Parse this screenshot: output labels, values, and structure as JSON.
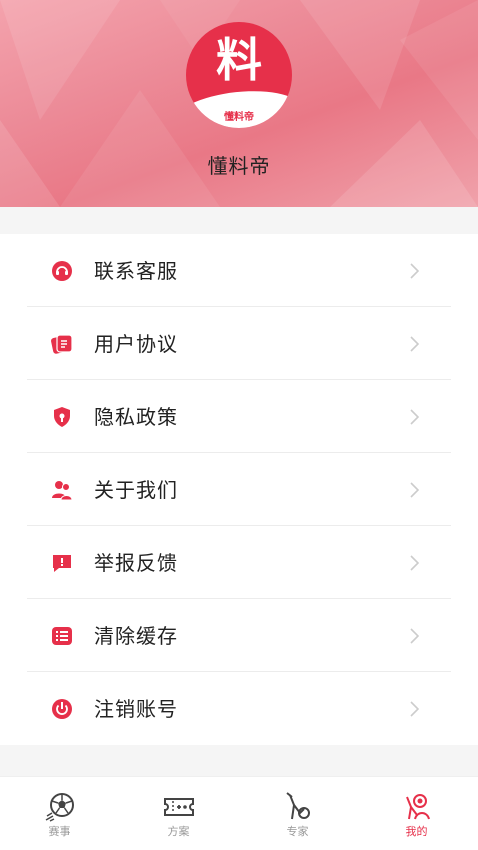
{
  "header": {
    "logo_glyph": "料",
    "logo_small": "懂料帝",
    "app_name": "懂料帝"
  },
  "menu": {
    "items": [
      {
        "label": "联系客服",
        "icon": "customer-service-icon"
      },
      {
        "label": "用户协议",
        "icon": "agreement-icon"
      },
      {
        "label": "隐私政策",
        "icon": "privacy-shield-icon"
      },
      {
        "label": "关于我们",
        "icon": "about-users-icon"
      },
      {
        "label": "举报反馈",
        "icon": "report-icon"
      },
      {
        "label": "清除缓存",
        "icon": "clear-cache-icon"
      },
      {
        "label": "注销账号",
        "icon": "power-icon"
      }
    ]
  },
  "tabbar": {
    "tabs": [
      {
        "label": "赛事",
        "icon": "soccer-ball-icon",
        "active": false
      },
      {
        "label": "方案",
        "icon": "ticket-icon",
        "active": false
      },
      {
        "label": "专家",
        "icon": "expert-icon",
        "active": false
      },
      {
        "label": "我的",
        "icon": "profile-icon",
        "active": true
      }
    ]
  },
  "colors": {
    "accent": "#e6304a",
    "header_pink": "#ec8a97",
    "text": "#222222",
    "tab_inactive": "#999999"
  }
}
